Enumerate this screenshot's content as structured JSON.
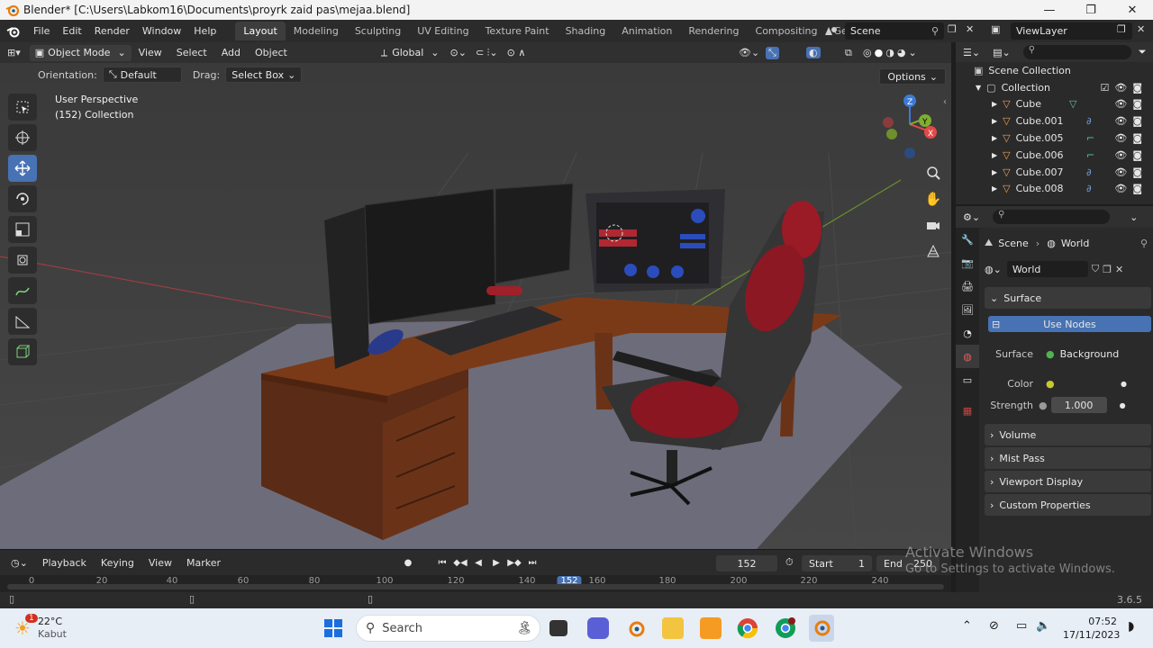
{
  "window": {
    "title": "Blender* [C:\\Users\\Labkom16\\Documents\\proyrk zaid pas\\mejaa.blend]",
    "minimize": "—",
    "maximize": "❐",
    "close": "✕"
  },
  "menu": {
    "items": [
      "File",
      "Edit",
      "Render",
      "Window",
      "Help"
    ],
    "workspaces": [
      "Layout",
      "Modeling",
      "Sculpting",
      "UV Editing",
      "Texture Paint",
      "Shading",
      "Animation",
      "Rendering",
      "Compositing",
      "Geometry Noc"
    ],
    "active_workspace": "Layout",
    "scene": "Scene",
    "view_layer": "ViewLayer"
  },
  "viewport_header": {
    "mode": "Object Mode",
    "items": [
      "View",
      "Select",
      "Add",
      "Object"
    ],
    "transform": "Global",
    "orientation_label": "Orientation:",
    "orientation_value": "Default",
    "drag_label": "Drag:",
    "drag_value": "Select Box",
    "options": "Options"
  },
  "viewport": {
    "perspective": "User Perspective",
    "collection": "(152) Collection"
  },
  "timeline": {
    "items": [
      "Playback",
      "Keying",
      "View",
      "Marker"
    ],
    "current_frame": "152",
    "start_label": "Start",
    "start": "1",
    "end_label": "End",
    "end": "250",
    "ticks": [
      "0",
      "20",
      "40",
      "60",
      "80",
      "100",
      "120",
      "140",
      "152",
      "160",
      "180",
      "200",
      "220",
      "240"
    ]
  },
  "outliner": {
    "scene_collection": "Scene Collection",
    "collection": "Collection",
    "objects": [
      "Cube",
      "Cube.001",
      "Cube.005",
      "Cube.006",
      "Cube.007",
      "Cube.008"
    ]
  },
  "properties": {
    "breadcrumb_scene": "Scene",
    "breadcrumb_world": "World",
    "world_name": "World",
    "surface_panel": "Surface",
    "use_nodes": "Use Nodes",
    "surface_label": "Surface",
    "surface_value": "Background",
    "color_label": "Color",
    "strength_label": "Strength",
    "strength_value": "1.000",
    "collapsed_panels": [
      "Volume",
      "Mist Pass",
      "Viewport Display",
      "Custom Properties"
    ]
  },
  "status": {
    "version": "3.6.5"
  },
  "watermark": {
    "line1": "Activate Windows",
    "line2": "Go to Settings to activate Windows."
  },
  "taskbar": {
    "weather_temp": "22°C",
    "weather_desc": "Kabut",
    "weather_badge": "1",
    "search": "Search",
    "time": "07:52",
    "date": "17/11/2023"
  }
}
